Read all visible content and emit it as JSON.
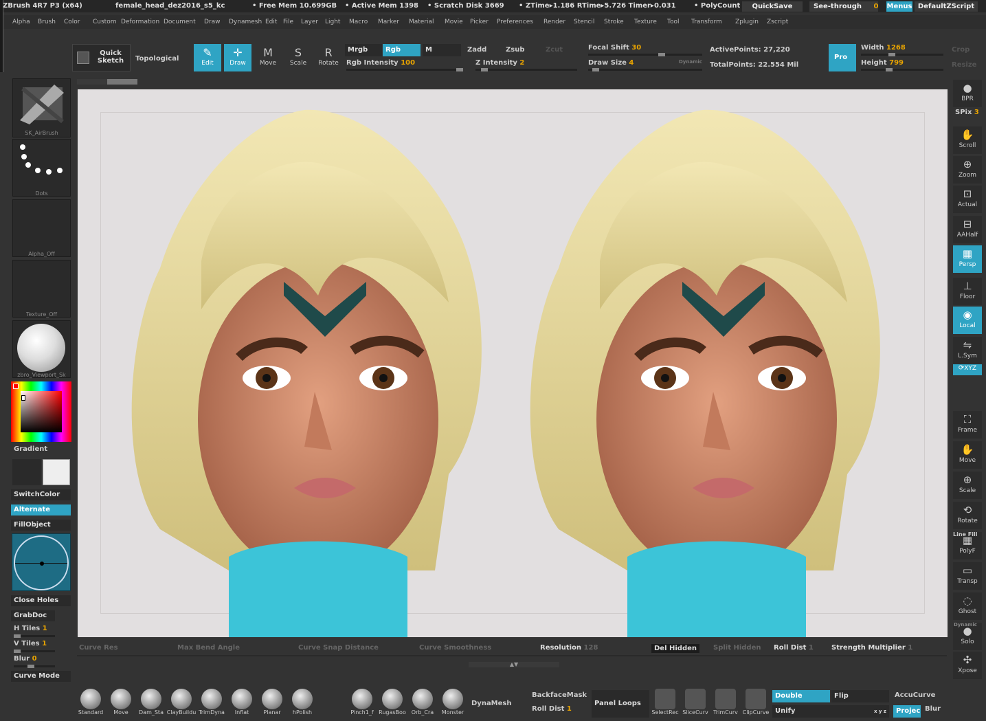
{
  "titlebar": {
    "app": "ZBrush 4R7 P3 (x64)",
    "document": "female_head_dez2016_s5_kc",
    "free_mem": "• Free Mem 10.699GB",
    "active_mem": "• Active Mem 1398",
    "scratch": "• Scratch Disk 3669",
    "ztime": "• ZTime▸1.186 RTime▸5.726 Timer▸0.031",
    "polycount": "• PolyCount",
    "quicksave": "QuickSave",
    "seethrough": "See-through",
    "seethrough_val": "0",
    "menus": "Menus",
    "defaultzscript": "DefaultZScript"
  },
  "menubar": [
    "Alpha",
    "Brush",
    "Color",
    "Custom",
    "Deformation",
    "Document",
    "Draw",
    "Dynamesh",
    "Edit",
    "File",
    "Layer",
    "Light",
    "Macro",
    "Marker",
    "Material",
    "Movie",
    "Picker",
    "Preferences",
    "Render",
    "Stencil",
    "Stroke",
    "Texture",
    "Tool",
    "Transform",
    "Zplugin",
    "Zscript"
  ],
  "toolbar": {
    "quicksketch": "Quick Sketch",
    "topological": "Topological",
    "tools": [
      {
        "label": "Edit",
        "icon": "edit-icon",
        "glyph": "✎",
        "on": true
      },
      {
        "label": "Draw",
        "icon": "draw-icon",
        "glyph": "✛",
        "on": true
      },
      {
        "label": "Move",
        "icon": "move-icon",
        "glyph": "M",
        "on": false
      },
      {
        "label": "Scale",
        "icon": "scale-icon",
        "glyph": "S",
        "on": false
      },
      {
        "label": "Rotate",
        "icon": "rotate-icon",
        "glyph": "R",
        "on": false
      }
    ],
    "mrgb": "Mrgb",
    "rgb": "Rgb",
    "m": "M",
    "zadd": "Zadd",
    "zsub": "Zsub",
    "zcut": "Zcut",
    "rgb_intensity_label": "Rgb Intensity",
    "rgb_intensity": "100",
    "z_intensity_label": "Z Intensity",
    "z_intensity": "2",
    "focal_shift_label": "Focal Shift",
    "focal_shift": "30",
    "draw_size_label": "Draw Size",
    "draw_size": "4",
    "dynamic": "Dynamic",
    "active_points": "ActivePoints: 27,220",
    "total_points": "TotalPoints: 22.554 Mil",
    "pro": "Pro",
    "width_label": "Width",
    "width": "1268",
    "height_label": "Height",
    "height": "799",
    "crop": "Crop",
    "resize": "Resize"
  },
  "left": {
    "brush": "SK_AirBrush",
    "stroke": "Dots",
    "alpha": "Alpha_Off",
    "texture": "Texture_Off",
    "material": "zbro_Viewport_Sk",
    "gradient": "Gradient",
    "switchcolor": "SwitchColor",
    "alternate": "Alternate",
    "fillobject": "FillObject",
    "closeholes": "Close Holes",
    "grabdoc": "GrabDoc",
    "htiles_label": "H Tiles",
    "htiles": "1",
    "vtiles_label": "V Tiles",
    "vtiles": "1",
    "blur_label": "Blur",
    "blur": "0",
    "curvemode": "Curve Mode"
  },
  "right": [
    {
      "label": "BPR",
      "icon": "bpr-icon",
      "glyph": "●",
      "on": false
    },
    {
      "label": "Scroll",
      "icon": "scroll-icon",
      "glyph": "✋",
      "on": false
    },
    {
      "label": "Zoom",
      "icon": "zoom-icon",
      "glyph": "⊕",
      "on": false
    },
    {
      "label": "Actual",
      "icon": "actual-icon",
      "glyph": "⊡",
      "on": false
    },
    {
      "label": "AAHalf",
      "icon": "aahalf-icon",
      "glyph": "⊟",
      "on": false
    },
    {
      "label": "Persp",
      "icon": "persp-icon",
      "glyph": "▦",
      "on": true
    },
    {
      "label": "Floor",
      "icon": "floor-icon",
      "glyph": "⊥",
      "on": false
    },
    {
      "label": "Local",
      "icon": "local-icon",
      "glyph": "◉",
      "on": true
    },
    {
      "label": "L.Sym",
      "icon": "lsym-icon",
      "glyph": "⇋",
      "on": false
    },
    {
      "label": "XYZ",
      "icon": "xyz-icon",
      "glyph": "⟳",
      "on": true
    },
    {
      "label": "Frame",
      "icon": "frame-icon",
      "glyph": "⛶",
      "on": false
    },
    {
      "label": "Move",
      "icon": "move-view-icon",
      "glyph": "✋",
      "on": false
    },
    {
      "label": "Scale",
      "icon": "scale-view-icon",
      "glyph": "⊕",
      "on": false
    },
    {
      "label": "Rotate",
      "icon": "rotate-view-icon",
      "glyph": "⟲",
      "on": false
    },
    {
      "label": "PolyF",
      "icon": "polyf-icon",
      "glyph": "▦",
      "on": false
    },
    {
      "label": "Transp",
      "icon": "transp-icon",
      "glyph": "▭",
      "on": false
    },
    {
      "label": "Ghost",
      "icon": "ghost-icon",
      "glyph": "◌",
      "on": false
    },
    {
      "label": "Solo",
      "icon": "solo-icon",
      "glyph": "●",
      "on": false
    },
    {
      "label": "Xpose",
      "icon": "xpose-icon",
      "glyph": "✣",
      "on": false
    }
  ],
  "spix_label": "SPix",
  "spix": "3",
  "dynamic_label": "Dynamic",
  "linefill": "Line Fill",
  "curvebar": {
    "curve_res": "Curve Res",
    "max_bend": "Max Bend Angle",
    "snap": "Curve Snap Distance",
    "smooth": "Curve Smoothness",
    "resolution_label": "Resolution",
    "resolution": "128",
    "del_hidden": "Del Hidden",
    "split_hidden": "Split Hidden",
    "roll_dist_label": "Roll Dist",
    "roll_dist": "1",
    "strength_label": "Strength Multiplier",
    "strength": "1"
  },
  "dock": {
    "brushes": [
      "Standard",
      "Move",
      "Dam_Sta",
      "ClayBuildu",
      "TrimDyna",
      "Inflat",
      "Planar",
      "hPolish"
    ],
    "brushes2": [
      "Pinch1_f",
      "RugasBoo",
      "Orb_Cra",
      "Monster"
    ],
    "dynamesh": "DynaMesh",
    "backfacemask": "BackfaceMask",
    "rolldist_label": "Roll Dist",
    "rolldist": "1",
    "panelloops": "Panel Loops",
    "selectrect": "SelectRec",
    "slicecurve": "SliceCurv",
    "trimcurve": "TrimCurv",
    "clipcurve": "ClipCurve",
    "double": "Double",
    "flip": "Flip",
    "accucurve": "AccuCurve",
    "unify": "Unify",
    "xyz": "x y z",
    "project": "Projec",
    "blur": "Blur"
  }
}
